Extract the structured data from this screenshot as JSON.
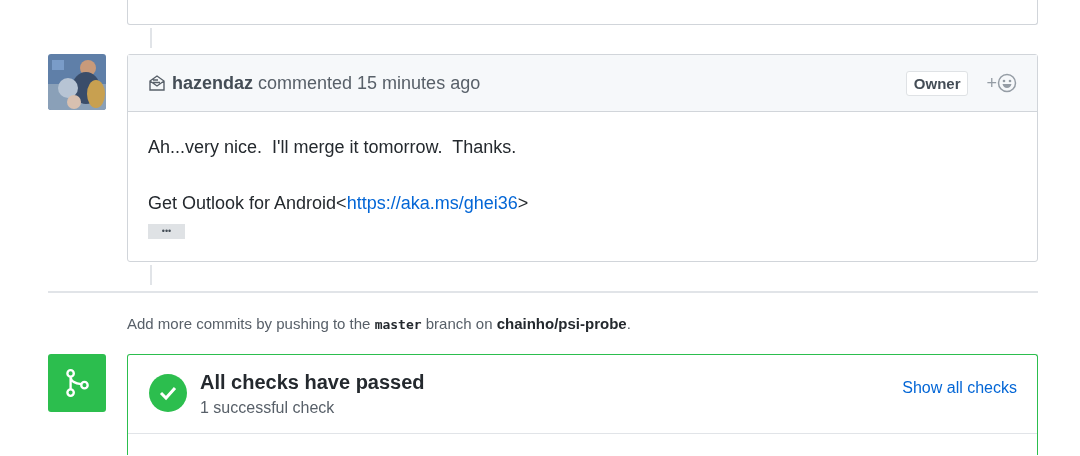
{
  "comment": {
    "author": "hazendaz",
    "action": "commented 15 minutes ago",
    "role_badge": "Owner",
    "reaction_button": "+",
    "body": [
      "Ah...very nice.  I'll merge it tomorrow.  Thanks."
    ],
    "signature": {
      "text": "Get Outlook for Android<",
      "link": "https://aka.ms/ghei36",
      "suffix": ">"
    },
    "more_button": "•••"
  },
  "push_hint": [
    {
      "kind": "text",
      "text": "Add more commits by pushing to the "
    },
    {
      "kind": "code",
      "text": "master"
    },
    {
      "kind": "text",
      "text": " branch on "
    },
    {
      "kind": "bold",
      "text": "chainho/psi-probe"
    },
    {
      "kind": "text",
      "text": "."
    }
  ],
  "merge_box": {
    "title": "All checks have passed",
    "subtitle": "1 successful check",
    "link": "Show all checks",
    "passed": true
  }
}
